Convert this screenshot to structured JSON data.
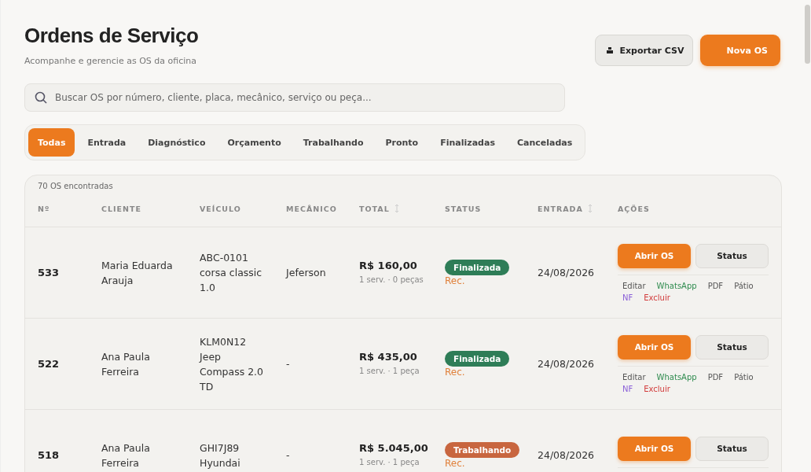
{
  "header": {
    "title": "Ordens de Serviço",
    "subtitle": "Acompanhe e gerencie as OS da oficina",
    "buttons": [
      {
        "label": "Exportar CSV",
        "kind": "export"
      },
      {
        "label": "Nova OS",
        "kind": "primary"
      }
    ]
  },
  "search": {
    "placeholder": "Buscar OS por número, cliente, placa, mecânico, serviço ou peça..."
  },
  "tabs": [
    {
      "label": "Todas",
      "selected": true
    },
    {
      "label": "Entrada",
      "selected": false
    },
    {
      "label": "Diagnóstico",
      "selected": false
    },
    {
      "label": "Orçamento",
      "selected": false
    },
    {
      "label": "Trabalhando",
      "selected": false
    },
    {
      "label": "Pronto",
      "selected": false
    },
    {
      "label": "Finalizadas",
      "selected": false
    },
    {
      "label": "Canceladas",
      "selected": false
    }
  ],
  "table": {
    "count": "70 OS encontradas",
    "columns": [
      {
        "label": "Nº",
        "sortable": false
      },
      {
        "label": "CLIENTE",
        "sortable": false
      },
      {
        "label": "VEÍCULO",
        "sortable": false
      },
      {
        "label": "MECÂNICO",
        "sortable": false
      },
      {
        "label": "TOTAL",
        "sortable": true
      },
      {
        "label": "STATUS",
        "sortable": false
      },
      {
        "label": "ENTRADA",
        "sortable": true
      },
      {
        "label": "AÇÕES",
        "sortable": false
      }
    ],
    "rows": [
      {
        "number": "533",
        "client": "Maria Eduarda Arauja",
        "vehicle": "ABC-0101 corsa classic 1.0",
        "mechanic": "Jeferson",
        "total": "R$ 160,00",
        "items": "1 serv. · 0 peças",
        "status": {
          "label": "Finalizada",
          "color": "#2e7d57"
        },
        "note": "Rec.",
        "date": "24/08/2026",
        "buttons": [
          "Abrir OS",
          "Status"
        ],
        "links": [
          {
            "label": "Editar",
            "kind": "plain"
          },
          {
            "label": "WhatsApp",
            "kind": "whatsapp"
          },
          {
            "label": "PDF",
            "kind": "plain"
          },
          {
            "label": "Pátio",
            "kind": "plain"
          },
          {
            "label": "NF",
            "kind": "nf"
          },
          {
            "label": "Excluir",
            "kind": "danger"
          }
        ]
      },
      {
        "number": "522",
        "client": "Ana Paula Ferreira",
        "vehicle": "KLM0N12 Jeep Compass 2.0 TD",
        "mechanic": "-",
        "total": "R$ 435,00",
        "items": "1 serv. · 1 peça",
        "status": {
          "label": "Finalizada",
          "color": "#2e7d57"
        },
        "note": "Rec.",
        "date": "24/08/2026",
        "buttons": [
          "Abrir OS",
          "Status"
        ],
        "links": [
          {
            "label": "Editar",
            "kind": "plain"
          },
          {
            "label": "WhatsApp",
            "kind": "whatsapp"
          },
          {
            "label": "PDF",
            "kind": "plain"
          },
          {
            "label": "Pátio",
            "kind": "plain"
          },
          {
            "label": "NF",
            "kind": "nf"
          },
          {
            "label": "Excluir",
            "kind": "danger"
          }
        ]
      },
      {
        "number": "518",
        "client": "Ana Paula Ferreira",
        "vehicle": "GHI7J89 Hyundai",
        "mechanic": "-",
        "total": "R$ 5.045,00",
        "items": "1 serv. · 1 peça",
        "status": {
          "label": "Trabalhando",
          "color": "#c8663f"
        },
        "note": "Rec.",
        "date": "24/08/2026",
        "buttons": [
          "Abrir OS",
          "Status"
        ]
      }
    ]
  }
}
